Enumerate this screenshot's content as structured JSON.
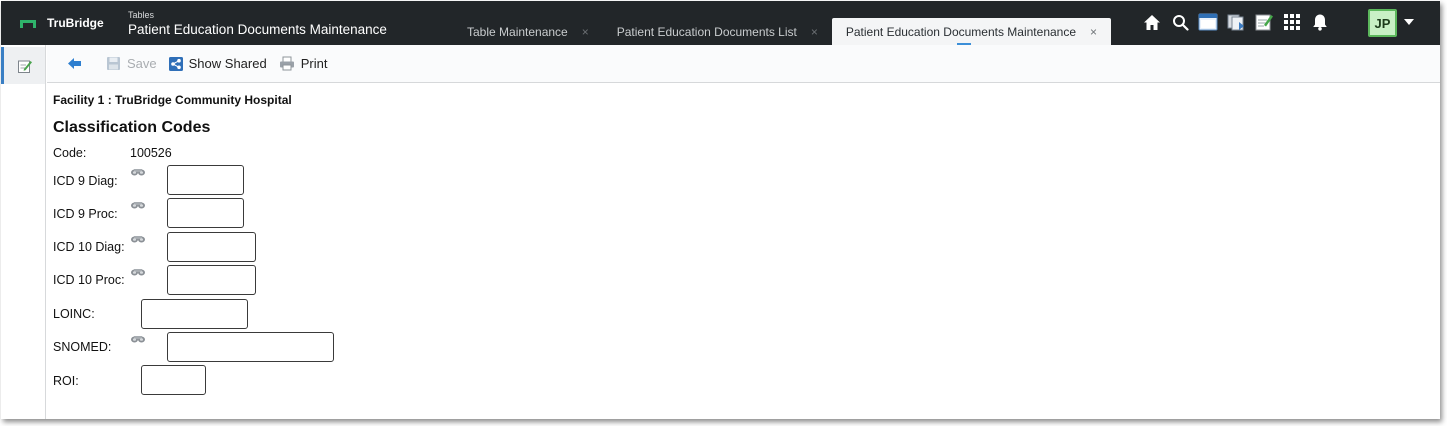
{
  "app": {
    "brand": "TruBridge",
    "section_label": "Tables",
    "window_title": "Patient Education Documents Maintenance"
  },
  "tabs": [
    {
      "label": "Table Maintenance",
      "active": false
    },
    {
      "label": "Patient Education Documents List",
      "active": false
    },
    {
      "label": "Patient Education Documents Maintenance",
      "active": true
    }
  ],
  "tab_close_glyph": "×",
  "header_icons": [
    "home-icon",
    "search-icon",
    "window-icon",
    "documents-icon",
    "notes-icon",
    "apps-grid-icon",
    "bell-icon"
  ],
  "user": {
    "initials": "JP"
  },
  "toolbar": {
    "save_label": "Save",
    "show_shared_label": "Show Shared",
    "print_label": "Print"
  },
  "facility": "Facility 1 : TruBridge Community Hospital",
  "section_title": "Classification Codes",
  "fields": {
    "code": {
      "label": "Code:",
      "value": "100526"
    },
    "icd9_diag": {
      "label": "ICD 9 Diag:",
      "value": ""
    },
    "icd9_proc": {
      "label": "ICD 9 Proc:",
      "value": ""
    },
    "icd10_diag": {
      "label": "ICD 10 Diag:",
      "value": ""
    },
    "icd10_proc": {
      "label": "ICD 10 Proc:",
      "value": ""
    },
    "loinc": {
      "label": "LOINC:",
      "value": ""
    },
    "snomed": {
      "label": "SNOMED:",
      "value": ""
    },
    "roi": {
      "label": "ROI:",
      "value": ""
    }
  },
  "colors": {
    "topbar": "#222629",
    "brand_green": "#2fb36b",
    "avatar_bg": "#c8f0c5",
    "accent_blue": "#3a7fc4"
  }
}
